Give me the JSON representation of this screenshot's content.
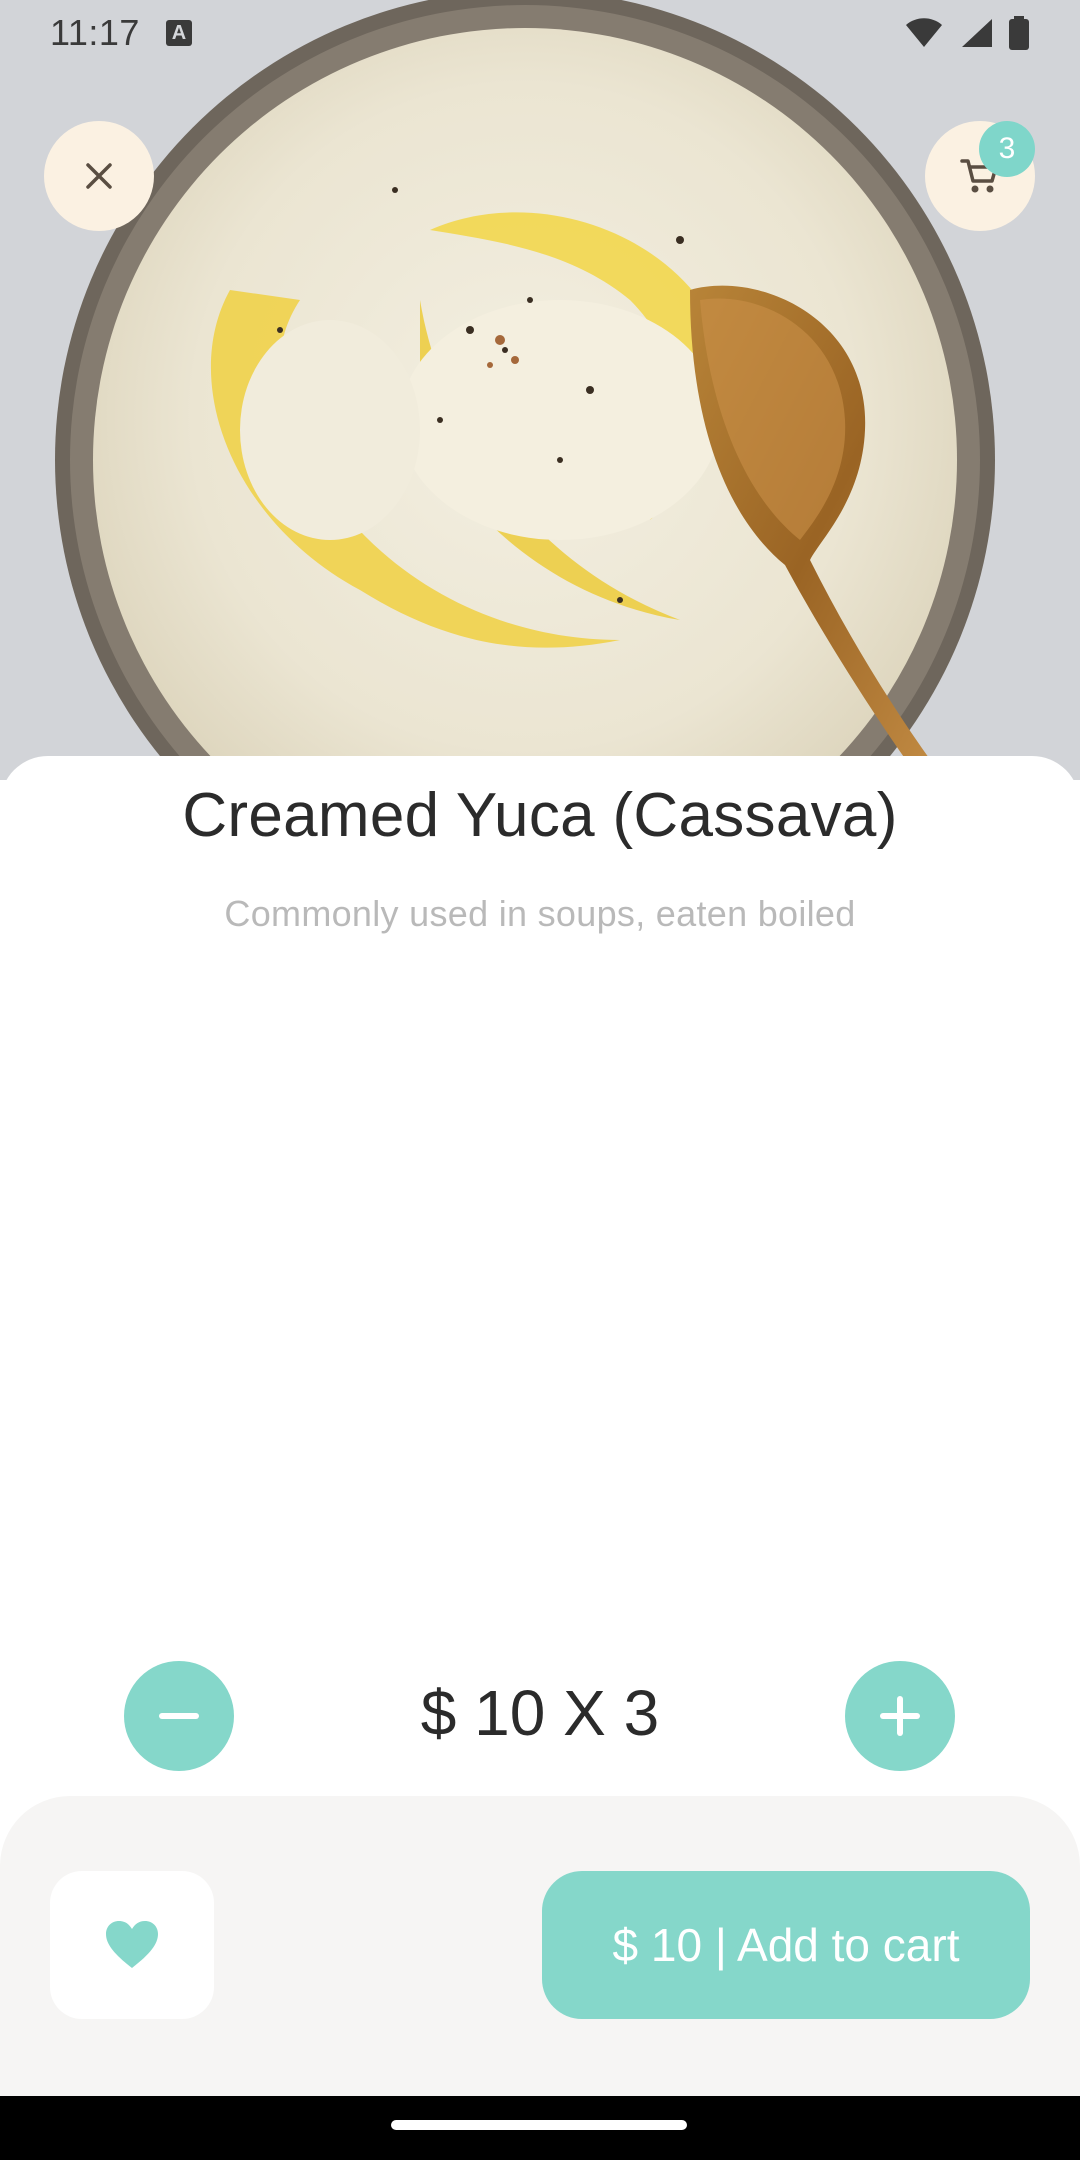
{
  "status_bar": {
    "time": "11:17",
    "notification_icon": "keyboard-a-icon",
    "icons": [
      "wifi-icon",
      "signal-icon",
      "battery-icon"
    ]
  },
  "header": {
    "close_icon": "close-icon",
    "cart_icon": "cart-icon",
    "cart_count": "3"
  },
  "product": {
    "image_subject": "creamed yuca in a bowl with a spoon",
    "title": "Creamed Yuca (Cassava)",
    "description": "Commonly used in soups, eaten boiled"
  },
  "quantity": {
    "display": "$ 10 X 3",
    "decrease_icon": "minus-icon",
    "increase_icon": "plus-icon"
  },
  "actions": {
    "favorite_icon": "heart-icon",
    "add_to_cart_label": "$ 10 | Add to cart"
  },
  "colors": {
    "accent": "#85d7ca",
    "button_bg": "#fbf1e2",
    "panel_bg": "#f6f5f4",
    "title_text": "#2b2b2b",
    "muted_text": "#b9b9b9"
  }
}
